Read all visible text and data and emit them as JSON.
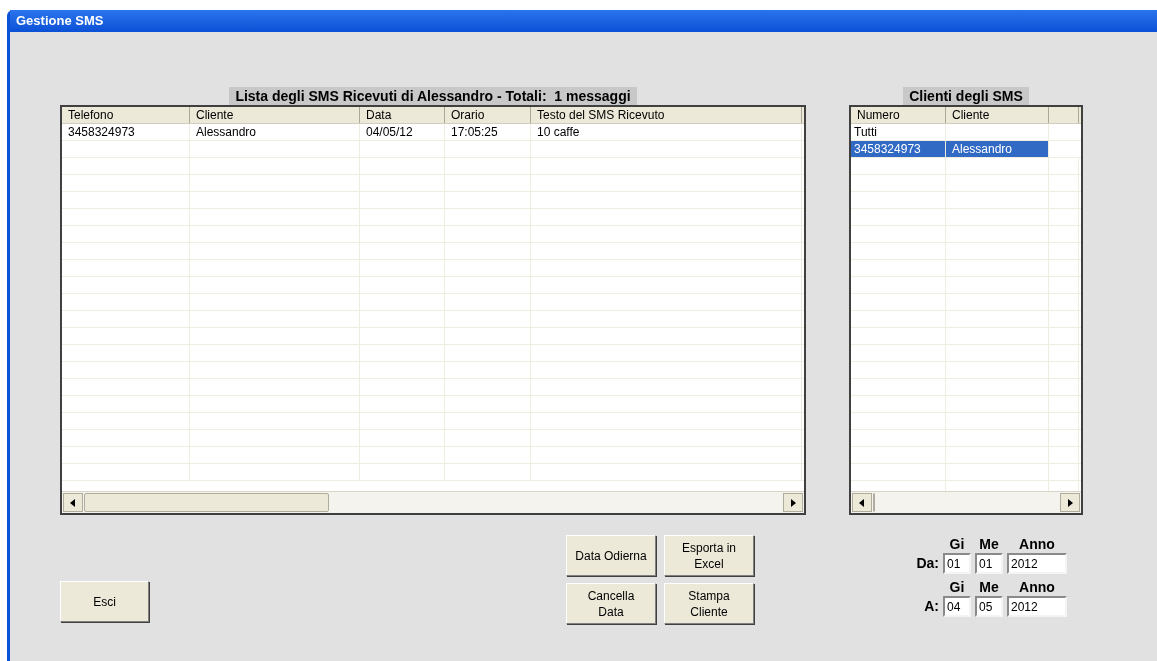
{
  "window": {
    "title": "Gestione SMS"
  },
  "messages": {
    "title": "Lista degli SMS Ricevuti di Alessandro - Totali:  1 messaggi",
    "columns": [
      "Telefono",
      "Cliente",
      "Data",
      "Orario",
      "Testo del SMS Ricevuto"
    ],
    "rows": [
      [
        "3458324973",
        "Alessandro",
        "04/05/12",
        "17:05:25",
        "10 caffe"
      ]
    ]
  },
  "clients": {
    "title": "Clienti degli SMS",
    "columns": [
      "Numero",
      "Cliente"
    ],
    "rows": [
      {
        "numero": "Tutti",
        "selected": false
      },
      {
        "numero": "3458324973",
        "cliente": "Alessandro",
        "selected": true
      }
    ]
  },
  "exit_button": "Esci",
  "button_rows": [
    [
      "Data Odierna",
      "Esporta in\nExcel"
    ],
    [
      "Cancella\nData",
      "Stampa\nCliente"
    ]
  ],
  "date_filter": [
    {
      "label": "Da:",
      "headers": [
        "Gi",
        "Me",
        "Anno"
      ],
      "values": [
        "01",
        "01",
        "2012"
      ]
    },
    {
      "label": "A:",
      "headers": [
        "Gi",
        "Me",
        "Anno"
      ],
      "values": [
        "04",
        "05",
        "2012"
      ]
    }
  ]
}
